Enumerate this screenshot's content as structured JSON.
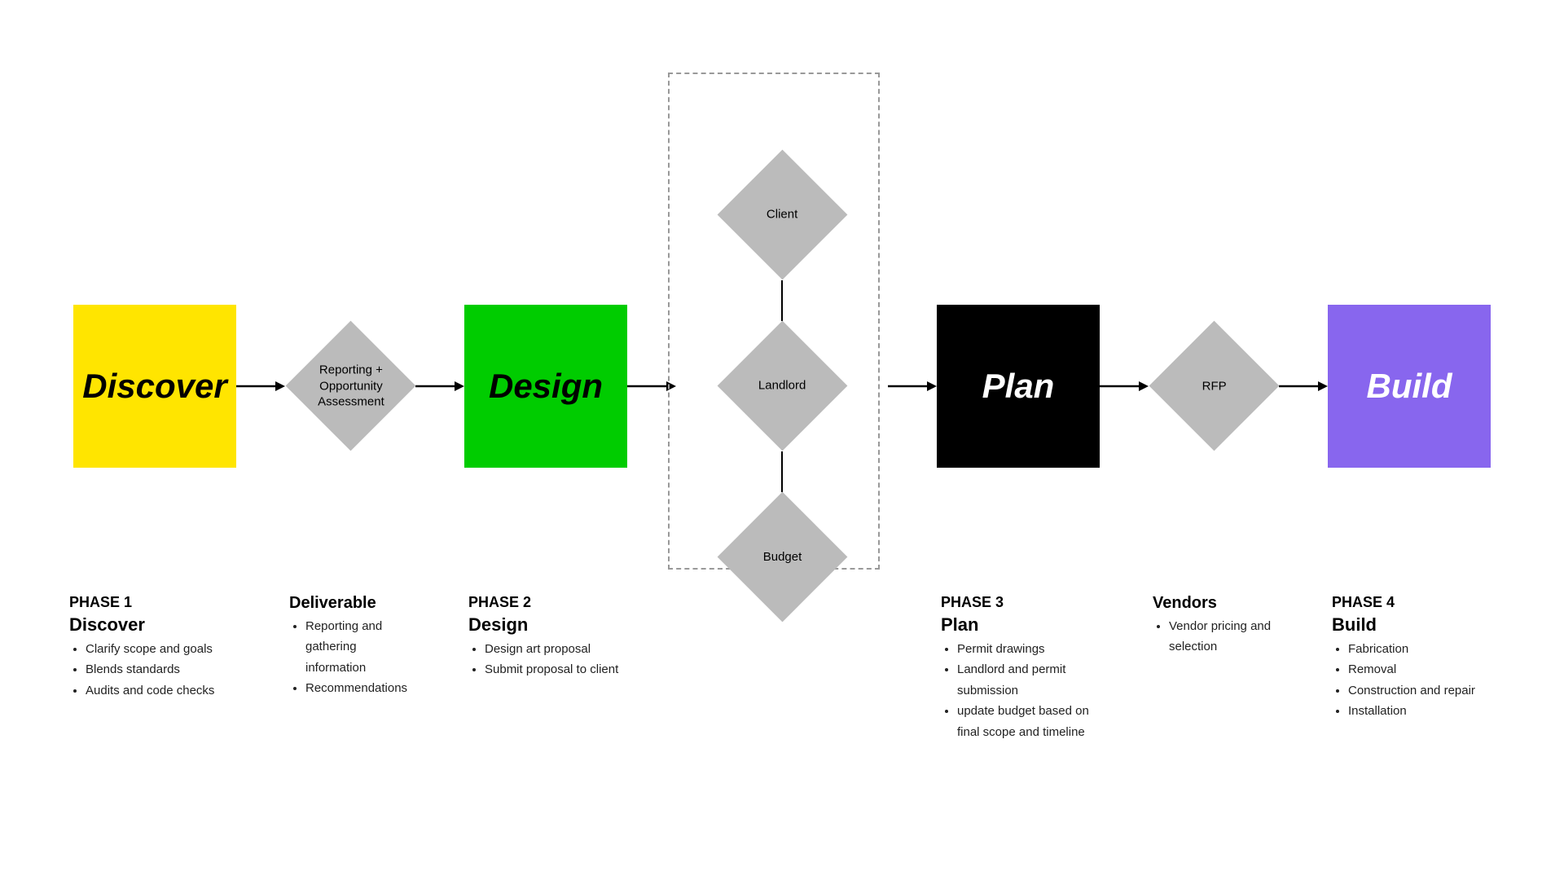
{
  "phases": {
    "discover": {
      "label": "Discover",
      "phase": "PHASE 1",
      "phase_title": "Discover",
      "bullets": [
        "Clarify scope and goals",
        "Blends standards",
        "Audits and code checks"
      ]
    },
    "deliverable": {
      "label": "Reporting +\nOpportunity\nAssessment",
      "deliverable_title": "Deliverable",
      "bullets": [
        "Reporting and gathering information",
        "Recommendations"
      ]
    },
    "design": {
      "label": "Design",
      "phase": "PHASE 2",
      "phase_title": "Design",
      "bullets": [
        "Design art proposal",
        "Submit proposal to client"
      ]
    },
    "client": {
      "label": "Client"
    },
    "landlord": {
      "label": "Landlord"
    },
    "budget": {
      "label": "Budget"
    },
    "plan": {
      "label": "Plan",
      "phase": "PHASE 3",
      "phase_title": "Plan",
      "bullets": [
        "Permit drawings",
        "Landlord and permit submission",
        "update budget based on final scope and timeline"
      ]
    },
    "rfp": {
      "label": "RFP",
      "vendors_title": "Vendors",
      "bullets": [
        "Vendor pricing and selection"
      ]
    },
    "build": {
      "label": "Build",
      "phase": "PHASE 4",
      "phase_title": "Build",
      "bullets": [
        "Fabrication",
        "Removal",
        "Construction and repair",
        "Installation"
      ]
    }
  },
  "arrows": {
    "right_arrow": "→"
  }
}
